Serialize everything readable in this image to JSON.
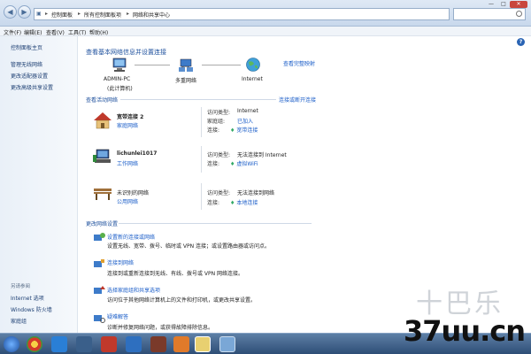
{
  "titlebar": {
    "back_glyph": "◀",
    "forward_glyph": "▶",
    "address": {
      "segments": [
        "控制面板",
        "所有控制面板项",
        "网络和共享中心"
      ],
      "separators": [
        "▸",
        "▸",
        "▸"
      ]
    },
    "window_controls": [
      "—",
      "□",
      "✕"
    ]
  },
  "menu": [
    "文件(F)",
    "编辑(E)",
    "查看(V)",
    "工具(T)",
    "帮助(H)"
  ],
  "sidebar": {
    "items": [
      "控制面板主页",
      "管理无线网络",
      "更改适配器设置",
      "更改高级共享设置"
    ],
    "see_also_header": "另请参阅",
    "see_also": [
      "Internet 选项",
      "Windows 防火墙",
      "家庭组"
    ]
  },
  "help_glyph": "?",
  "main": {
    "title": "查看基本网络信息并设置连接",
    "view_full_map": "查看完整映射",
    "map": {
      "computer_name": "ADMIN-PC",
      "computer_sub": "(此计算机)",
      "middle_label": "多重网络",
      "internet_label": "Internet"
    },
    "active_header": "查看活动网络",
    "connect_disconnect": "连接或断开连接",
    "networks": [
      {
        "name": "宽带连接 2",
        "type_link": "家庭网络",
        "access_label": "访问类型:",
        "access_value": "Internet",
        "group_label": "家庭组:",
        "group_value": "已加入",
        "conn_label": "连接:",
        "conn_value": "宽带连接"
      },
      {
        "name": "lichunlei1017",
        "type_link": "工作网络",
        "access_label": "访问类型:",
        "access_value": "无法连接到 Internet",
        "conn_label": "连接:",
        "conn_value": "虚拟WiFi"
      },
      {
        "name": "未识别的网络",
        "type_link": "公用网络",
        "access_label": "访问类型:",
        "access_value": "无法连接到网络",
        "conn_label": "连接:",
        "conn_value": "本地连接"
      }
    ],
    "change_header": "更改网络设置",
    "tasks": [
      {
        "title": "设置新的连接或网络",
        "desc": "设置无线、宽带、拨号、临时或 VPN 连接；或设置路由器或访问点。"
      },
      {
        "title": "连接到网络",
        "desc": "连接到或重新连接到无线、有线、拨号或 VPN 网络连接。"
      },
      {
        "title": "选择家庭组和共享选项",
        "desc": "访问位于其他网络计算机上的文件和打印机，或更改共享设置。"
      },
      {
        "title": "疑难解答",
        "desc": "诊断并修复网络问题，或获得故障排除信息。"
      }
    ]
  },
  "watermark": {
    "text": "37uu.cn",
    "faint": "十巴乐"
  },
  "colors": {
    "link": "#1a5dc8",
    "heading": "#1c4f9c",
    "taskbar": "#3a5b85"
  }
}
